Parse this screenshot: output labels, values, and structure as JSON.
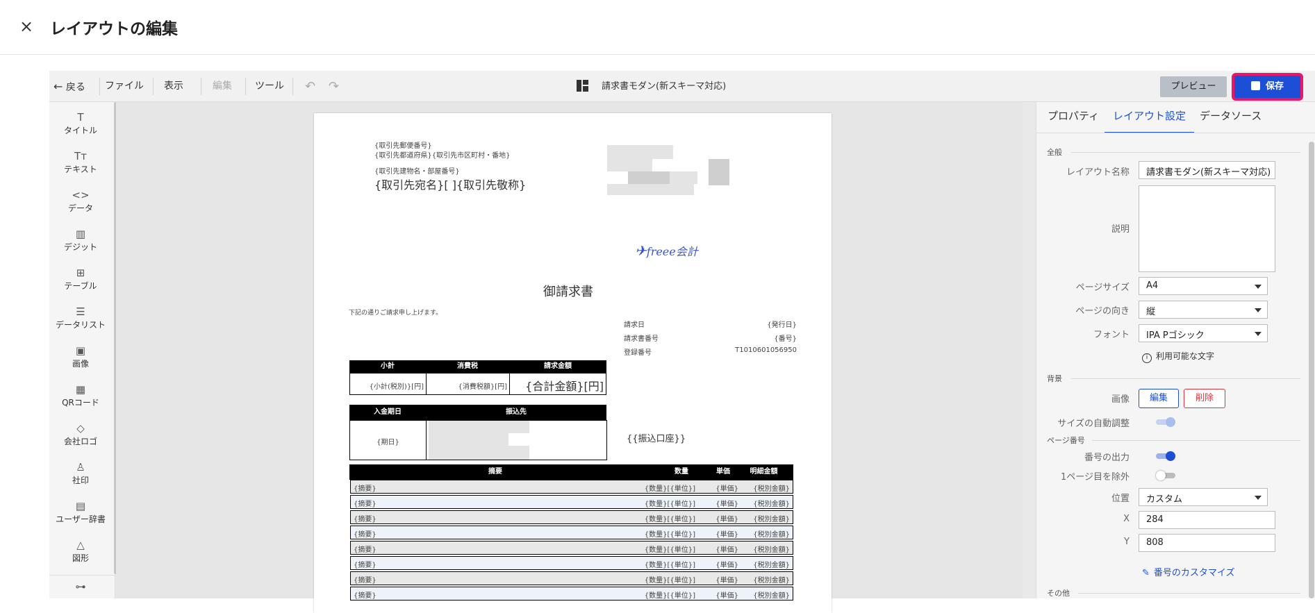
{
  "header": {
    "close_glyph": "×",
    "title": "レイアウトの編集"
  },
  "toolbar": {
    "back": "戻る",
    "file": "ファイル",
    "view": "表示",
    "edit": "編集",
    "tools": "ツール",
    "undo_glyph": "↶",
    "redo_glyph": "↷",
    "document_name": "請求書モダン(新スキーマ対応)",
    "preview": "プレビュー",
    "save": "保存"
  },
  "tools": [
    {
      "icon": "T",
      "label": "タイトル"
    },
    {
      "icon": "Tт",
      "label": "テキスト"
    },
    {
      "icon": "<>",
      "label": "データ"
    },
    {
      "icon": "▥",
      "label": "デジット"
    },
    {
      "icon": "⊞",
      "label": "テーブル"
    },
    {
      "icon": "☰",
      "label": "データリスト"
    },
    {
      "icon": "▣",
      "label": "画像"
    },
    {
      "icon": "▦",
      "label": "QRコード"
    },
    {
      "icon": "◇",
      "label": "会社ロゴ"
    },
    {
      "icon": "♙",
      "label": "社印"
    },
    {
      "icon": "▤",
      "label": "ユーザー辞書"
    },
    {
      "icon": "△",
      "label": "図形"
    },
    {
      "icon": "⊶",
      "label": ""
    }
  ],
  "sheet": {
    "postal": "{取引先郵便番号}",
    "address1": "{取引先都道府県}{取引先市区町村・番地}",
    "address2": "{取引先建物名・部屋番号}",
    "recipient": "{取引先宛名}[ ]{取引先敬称}",
    "logo_text": "freee会計",
    "doc_title": "御請求書",
    "greeting": "下記の通りご請求申し上げます。",
    "meta": [
      {
        "label": "請求日",
        "value": "{発行日}"
      },
      {
        "label": "請求書番号",
        "value": "{番号}"
      },
      {
        "label": "登録番号",
        "value": "T1010601056950"
      }
    ],
    "summary_headers": [
      "小計",
      "消費税",
      "請求金額"
    ],
    "summary_values": [
      "{小計(税別)}[円]",
      "{消費税額}[円]",
      "{合計金額}[円]"
    ],
    "payment_headers": [
      "入金期日",
      "振込先"
    ],
    "payment_due": "{期日}",
    "bank_account": "{{振込口座}}",
    "items_headers": [
      "摘要",
      "数量",
      "単価",
      "明細金額"
    ],
    "item_row": {
      "desc": "{摘要}",
      "qty": "{数量}[{単位}]",
      "price": "{単価}",
      "amount": "{税別金額}"
    }
  },
  "right_panel": {
    "tabs": [
      "プロパティ",
      "レイアウト設定",
      "データソース"
    ],
    "general_section": "全般",
    "layout_name_label": "レイアウト名称",
    "layout_name_value": "請求書モダン(新スキーマ対応)",
    "description_label": "説明",
    "page_size_label": "ページサイズ",
    "page_size_value": "A4",
    "orientation_label": "ページの向き",
    "orientation_value": "縦",
    "font_label": "フォント",
    "font_value": "IPA Pゴシック",
    "available_chars": "利用可能な文字",
    "background_section": "背景",
    "image_label": "画像",
    "edit_button": "編集",
    "delete_button": "削除",
    "auto_size_label": "サイズの自動調整",
    "page_number_section": "ページ番号",
    "number_output_label": "番号の出力",
    "exclude_first_label": "1ページ目を除外",
    "position_label": "位置",
    "position_value": "カスタム",
    "x_label": "X",
    "x_value": "284",
    "y_label": "Y",
    "y_value": "808",
    "customize_link": "番号のカスタマイズ",
    "other_section": "その他"
  },
  "colors": {
    "accent": "#1d4fd6",
    "save_outline": "#e8176b",
    "delete": "#d9363e"
  }
}
